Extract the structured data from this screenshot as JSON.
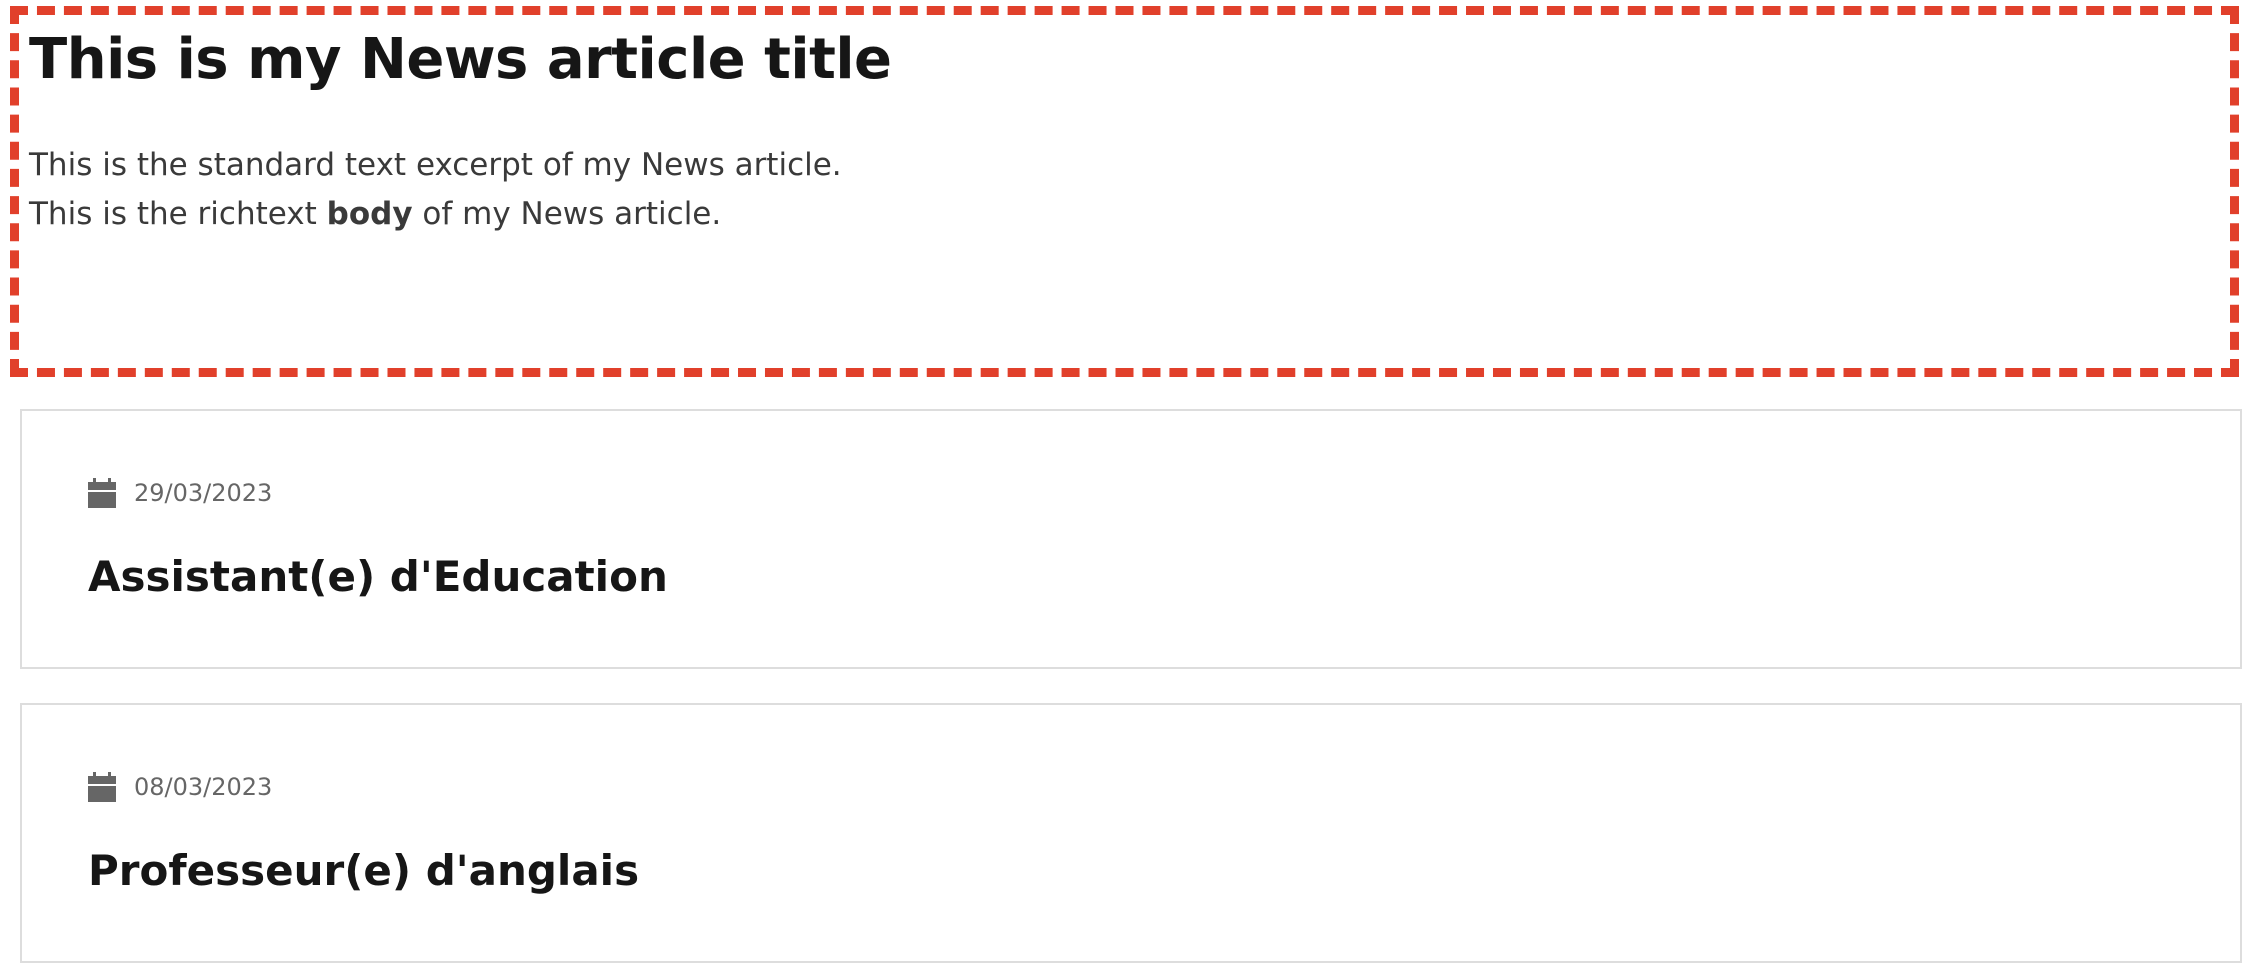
{
  "article": {
    "title": "This is my News article title",
    "excerpt": "This is the standard text excerpt of my News article.",
    "body_prefix": "This is the richtext ",
    "body_bold": "body",
    "body_suffix": " of my News article.",
    "highlight_color": "#e1402b"
  },
  "cards": [
    {
      "date": "29/03/2023",
      "title": "Assistant(e) d'Education",
      "icon": "calendar-icon"
    },
    {
      "date": "08/03/2023",
      "title": "Professeur(e) d'anglais",
      "icon": "calendar-icon"
    }
  ]
}
